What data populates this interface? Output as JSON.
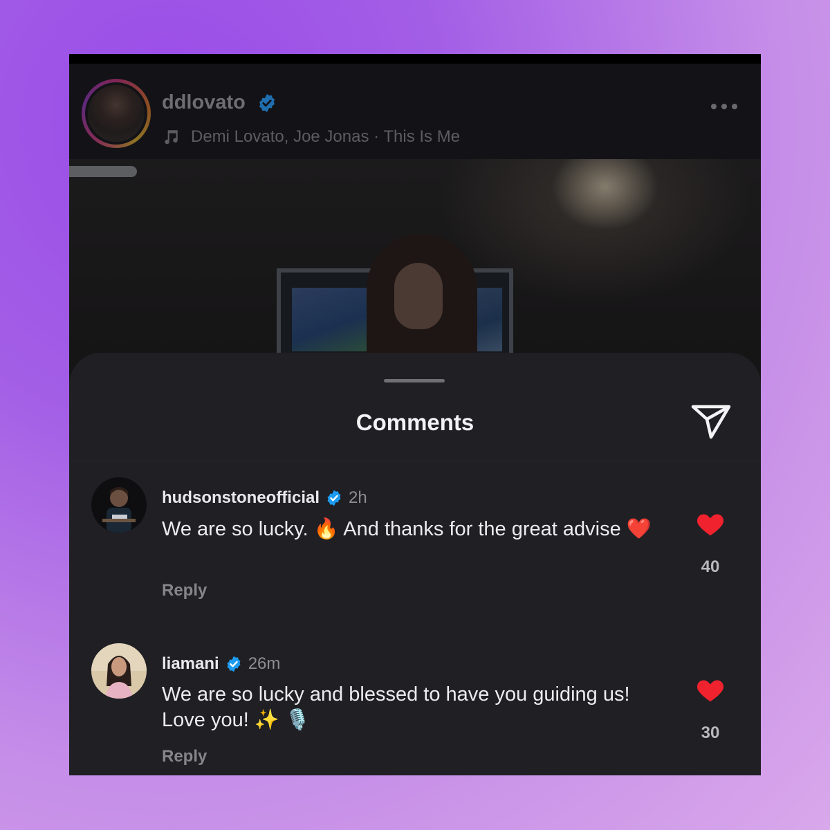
{
  "post": {
    "username": "ddlovato",
    "music": "Demi Lovato, Joe Jonas · This Is Me"
  },
  "sheet": {
    "title": "Comments"
  },
  "comments": [
    {
      "username": "hudsonstoneofficial",
      "time": "2h",
      "text_a": "We are so lucky. ",
      "emoji_a": "🔥",
      "text_b": " And thanks for the great advise ",
      "emoji_b": "❤️",
      "reply": "Reply",
      "likes": "40"
    },
    {
      "username": "liamani",
      "time": "26m",
      "text_a": "We are so lucky and blessed to have you guiding us! Love you! ",
      "emoji_a": "✨",
      "emoji_b": "🎙️",
      "reply": "Reply",
      "likes": "30"
    }
  ],
  "colors": {
    "verified": "#1d9bf0",
    "heart": "#f0222e",
    "sheet_bg": "#1f1f24"
  },
  "icons": [
    "music-note-icon",
    "verified-badge-icon",
    "more-options-icon",
    "share-send-icon",
    "heart-icon"
  ]
}
